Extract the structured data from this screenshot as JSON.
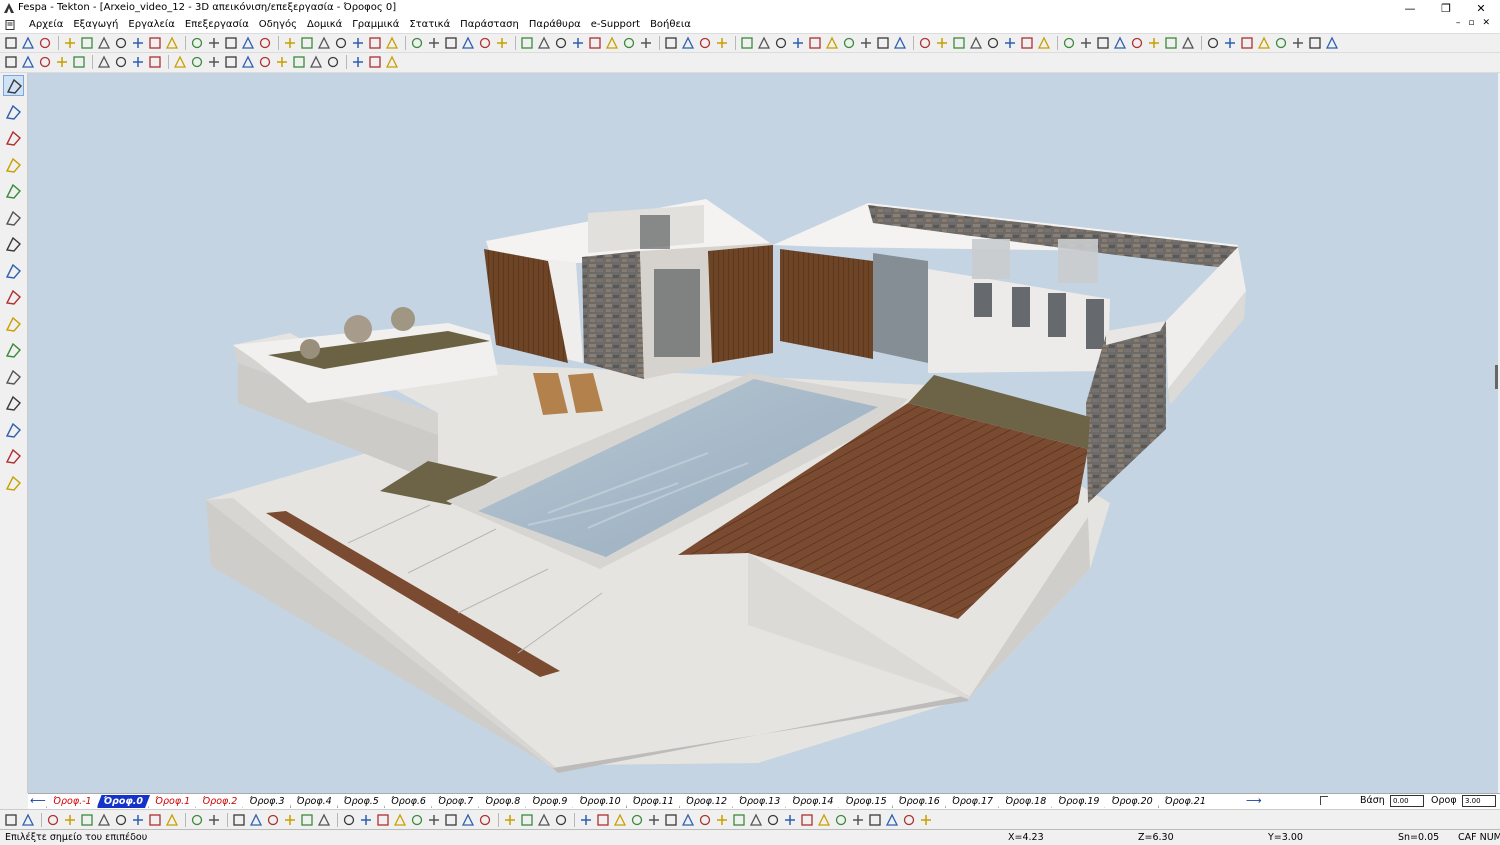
{
  "window": {
    "title": "Fespa - Tekton - [Arxeio_video_12 - 3D απεικόνιση/επεξεργασία - Όροφος 0]",
    "minimize": "—",
    "restore": "❐",
    "close": "✕"
  },
  "menu": {
    "items": [
      "Αρχεία",
      "Εξαγωγή",
      "Εργαλεία",
      "Επεξεργασία",
      "Οδηγός",
      "Δομικά",
      "Γραμμικά",
      "Στατικά",
      "Παράσταση",
      "Παράθυρα",
      "e-Support",
      "Βοήθεια"
    ],
    "mdi_minimize": "–",
    "mdi_restore": "▫",
    "mdi_close": "✕"
  },
  "floors": {
    "tabs": [
      "Όροφ.-1",
      "Όροφ.0",
      "Όροφ.1",
      "Όροφ.2",
      "Όροφ.3",
      "Όροφ.4",
      "Όροφ.5",
      "Όροφ.6",
      "Όροφ.7",
      "Όροφ.8",
      "Όροφ.9",
      "Όροφ.10",
      "Όροφ.11",
      "Όροφ.12",
      "Όροφ.13",
      "Όροφ.14",
      "Όροφ.15",
      "Όροφ.16",
      "Όροφ.17",
      "Όροφ.18",
      "Όροφ.19",
      "Όροφ.20",
      "Όροφ.21"
    ],
    "active_index": 1,
    "red_indices": [
      0,
      2,
      3
    ],
    "left_arrow": "⟵",
    "right_arrow": "⟶",
    "base_label": "Βάση",
    "base_value": "0.00",
    "floor_label": "Οροφ",
    "floor_value": "3.00"
  },
  "status": {
    "message": "Επιλέξτε σημείο του επιπέδου",
    "x": "X=4.23",
    "z": "Z=6.30",
    "y": "Y=3.00",
    "snap": "Sn=0.05",
    "modes": "CAF NUM"
  },
  "colors": {
    "viewport_bg": "#c5d4e2",
    "active_floor": "#1533c8",
    "red_floor_text": "#d00000",
    "pool_water": "#a9bccb",
    "wood_deck": "#7a4b30",
    "stone_wall": "#6d6a67"
  }
}
